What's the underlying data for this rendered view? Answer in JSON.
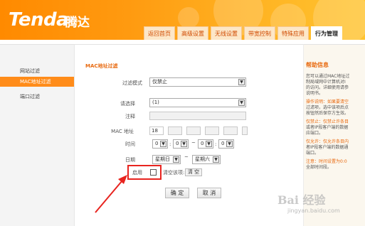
{
  "header": {
    "logo": "Tenda",
    "logo_cn": "腾达",
    "tabs": [
      {
        "label": "返回首页",
        "active": false
      },
      {
        "label": "高级设置",
        "active": false
      },
      {
        "label": "无线设置",
        "active": false
      },
      {
        "label": "带宽控制",
        "active": false
      },
      {
        "label": "特殊应用",
        "active": false
      },
      {
        "label": "行为管理",
        "active": true
      }
    ]
  },
  "sidebar": {
    "items": [
      {
        "label": "网站过滤",
        "active": false
      },
      {
        "label": "MAC地址过滤",
        "active": true
      },
      {
        "label": "端口过滤",
        "active": false
      }
    ]
  },
  "form": {
    "title": "MAC地址过滤",
    "filter_mode": {
      "label": "过滤模式",
      "value": "仅禁止"
    },
    "select": {
      "label": "请选择",
      "value": "(1)"
    },
    "note": {
      "label": "注释",
      "value": ""
    },
    "mac": {
      "label": "MAC 地址",
      "first_octet": "18"
    },
    "time": {
      "label": "时间",
      "h1": "0",
      "m1": "0",
      "sep": "~",
      "h2": "0",
      "m2": "0"
    },
    "date": {
      "label": "日期",
      "from": "星期日",
      "sep": "~",
      "to": "星期六"
    },
    "enable": {
      "label": "启用",
      "checked": false
    },
    "clear": {
      "label": "清空该项:",
      "button": "清 空"
    },
    "ok_button": "确 定",
    "cancel_button": "取 消"
  },
  "help": {
    "title": "帮助信息",
    "lines": [
      {
        "text": "您可以通过MAC地址过",
        "accent": false
      },
      {
        "text": "制局域网中计算机对I",
        "accent": false
      },
      {
        "text": "的访问。详细使用请参",
        "accent": false
      },
      {
        "text": "说明书。",
        "accent": false
      },
      {
        "text": "操作说明：如果要清空",
        "accent": true
      },
      {
        "text": "过滤项，选中该项后点",
        "accent": false
      },
      {
        "text": "按钮然后保存方生效。",
        "accent": false
      },
      {
        "text": "仅禁止：仅禁止许条目",
        "accent": true
      },
      {
        "text": "或者IP段客户端的数据",
        "accent": false
      },
      {
        "text": "应端口。",
        "accent": false
      },
      {
        "text": "仅允许：仅允许条目内",
        "accent": true
      },
      {
        "text": "者IP段客户端的数据通",
        "accent": false
      },
      {
        "text": "端口。",
        "accent": false
      },
      {
        "text": "注意：时间设置为0:0",
        "accent": true
      },
      {
        "text": "全部时间段。",
        "accent": false
      }
    ]
  },
  "watermark": {
    "main": "Bai 经验",
    "sub": "jingyan.baidu.com"
  },
  "colors": {
    "brand_orange": "#ff8c1a",
    "highlight_red": "#e8241f",
    "accent_text": "#e86a10"
  }
}
